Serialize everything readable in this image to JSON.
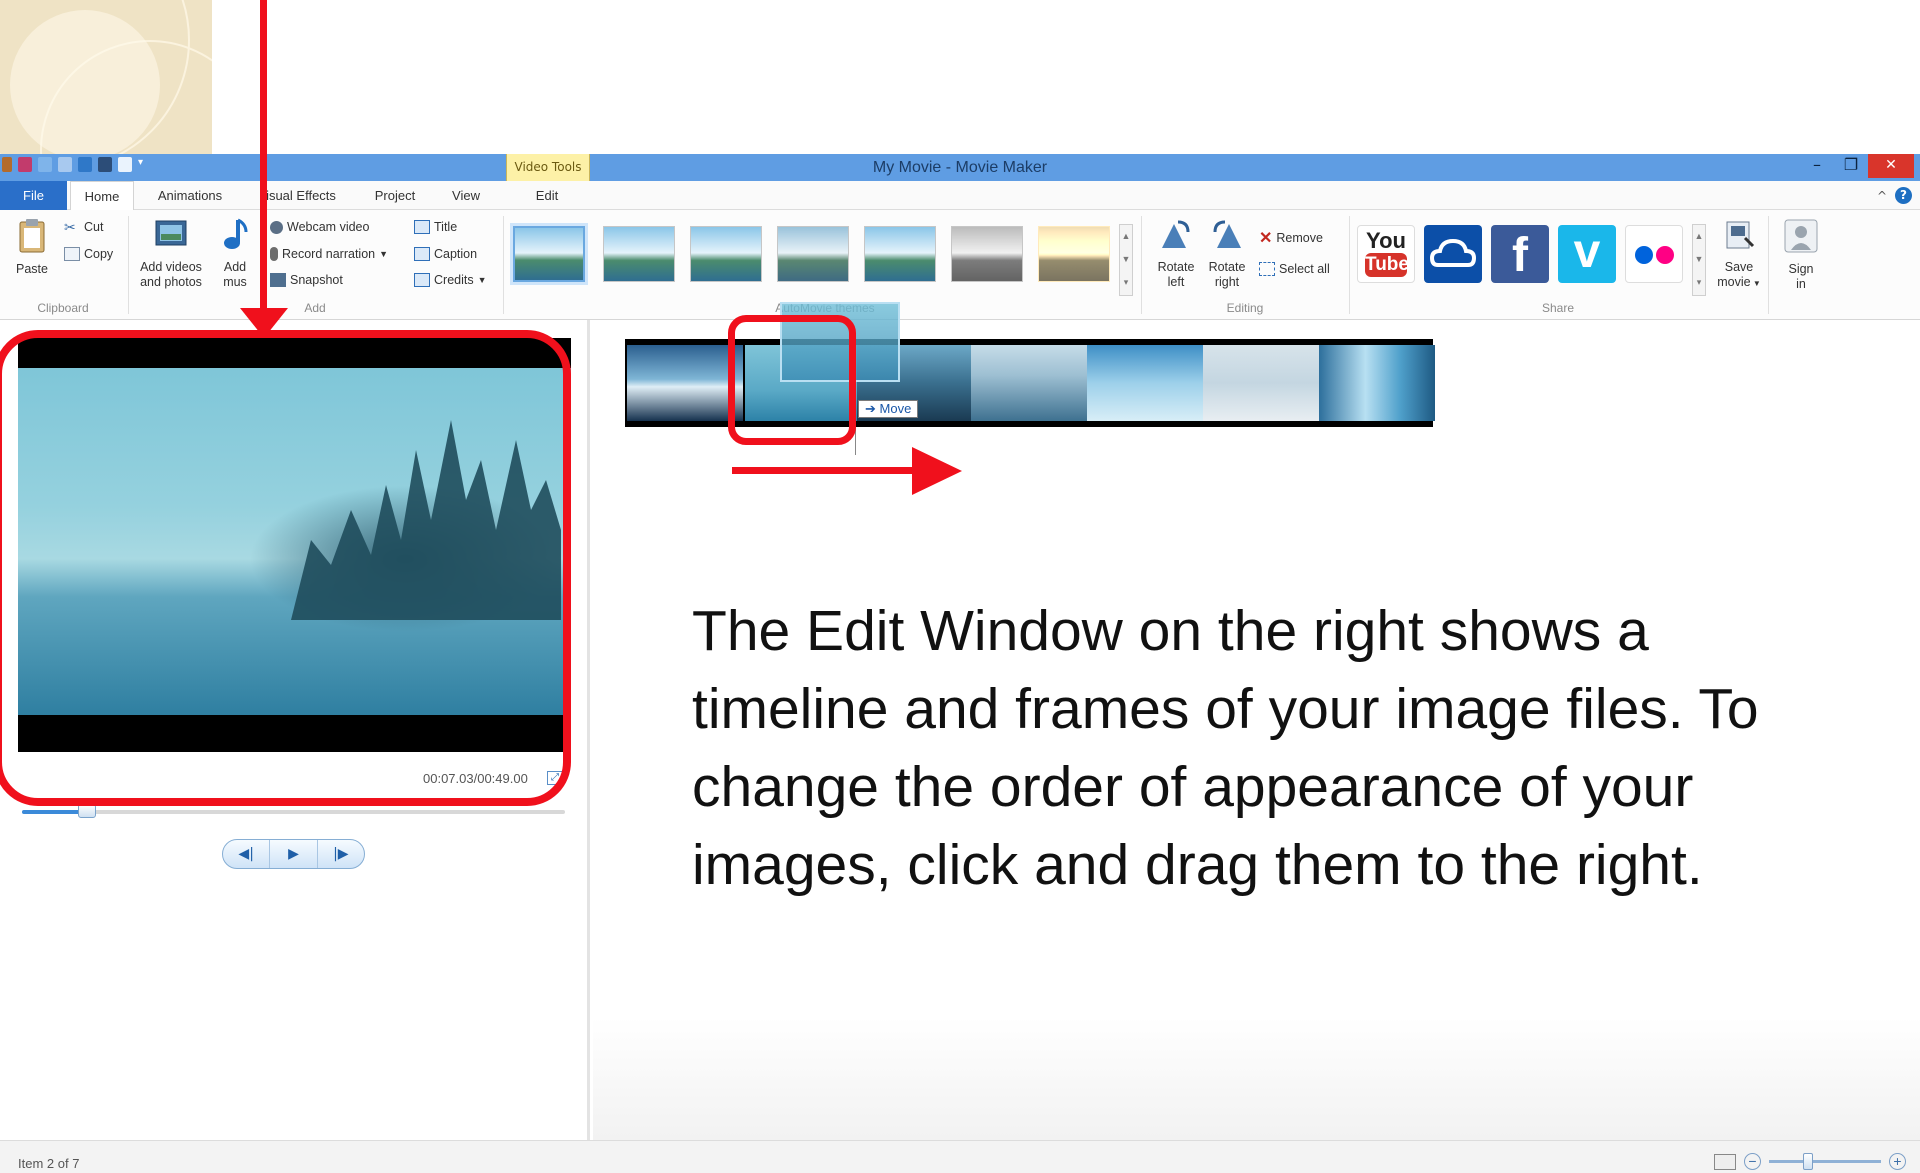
{
  "window": {
    "title": "My Movie - Movie Maker",
    "context_tab": "Video Tools",
    "minimize": "–",
    "restore": "❐",
    "close": "✕"
  },
  "tabs": {
    "file": "File",
    "home": "Home",
    "animations": "Animations",
    "visual_effects": "isual Effects",
    "project": "Project",
    "view": "View",
    "edit": "Edit",
    "help": "?",
    "collapse": "^"
  },
  "ribbon": {
    "clipboard": {
      "paste": "Paste",
      "cut": "Cut",
      "copy": "Copy",
      "label": "Clipboard"
    },
    "add": {
      "add_videos_line1": "Add videos",
      "add_videos_line2": "and photos",
      "add_music_line1": "Add",
      "add_music_line2": "mus",
      "webcam_video": "Webcam video",
      "record_narration": "Record narration",
      "snapshot": "Snapshot",
      "title": "Title",
      "caption": "Caption",
      "credits": "Credits",
      "label": "Add"
    },
    "automovie_label": "AutoMovie themes",
    "editing": {
      "rotate_left_line1": "Rotate",
      "rotate_left_line2": "left",
      "rotate_right_line1": "Rotate",
      "rotate_right_line2": "right",
      "remove": "Remove",
      "select_all": "Select all",
      "label": "Editing"
    },
    "share": {
      "youtube_top": "You",
      "youtube_bottom": "Tube",
      "facebook": "f",
      "vimeo": "v",
      "save_movie_line1": "Save",
      "save_movie_line2": "movie",
      "sign_in_line1": "Sign",
      "sign_in_line2": "in",
      "label": "Share"
    }
  },
  "preview": {
    "time_code": "00:07.03/00:49.00",
    "seek_progress": 0.12,
    "prev_frame": "◀|",
    "play": "▶",
    "next_frame": "|▶"
  },
  "timeline": {
    "move_label": "Move",
    "move_arrow": "➔"
  },
  "slide": {
    "body_text": "The Edit Window on the right shows a timeline and frames of your image files. To change the order of appearance of your images, click and drag them to the right."
  },
  "status": {
    "item_text": "Item 2 of 7",
    "zoom_level": 0.35,
    "zoom_out": "−",
    "zoom_in": "+"
  },
  "colors": {
    "annotation_red": "#f0101c",
    "titlebar_blue": "#5f9de3",
    "file_tab_blue": "#2a6fc9"
  }
}
